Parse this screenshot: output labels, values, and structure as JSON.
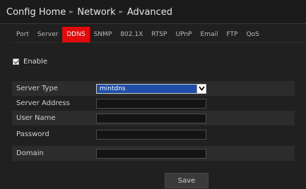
{
  "breadcrumb": {
    "items": [
      "Config Home",
      "Network",
      "Advanced"
    ]
  },
  "tabs": [
    {
      "label": "Port",
      "active": false
    },
    {
      "label": "Server",
      "active": false
    },
    {
      "label": "DDNS",
      "active": true
    },
    {
      "label": "SNMP",
      "active": false
    },
    {
      "label": "802.1X",
      "active": false
    },
    {
      "label": "RTSP",
      "active": false
    },
    {
      "label": "UPnP",
      "active": false
    },
    {
      "label": "Email",
      "active": false
    },
    {
      "label": "FTP",
      "active": false
    },
    {
      "label": "QoS",
      "active": false
    }
  ],
  "enable": {
    "label": "Enable",
    "checked": true
  },
  "form": {
    "server_type": {
      "label": "Server Type",
      "value": "mintdns"
    },
    "server_address": {
      "label": "Server Address",
      "value": ""
    },
    "user_name": {
      "label": "User Name",
      "value": ""
    },
    "password": {
      "label": "Password",
      "value": ""
    },
    "domain": {
      "label": "Domain",
      "value": ""
    }
  },
  "save_label": "Save",
  "colors": {
    "active_tab": "#e20a0a",
    "select_highlight": "#1f4ea8",
    "background": "#1b1b1b"
  }
}
